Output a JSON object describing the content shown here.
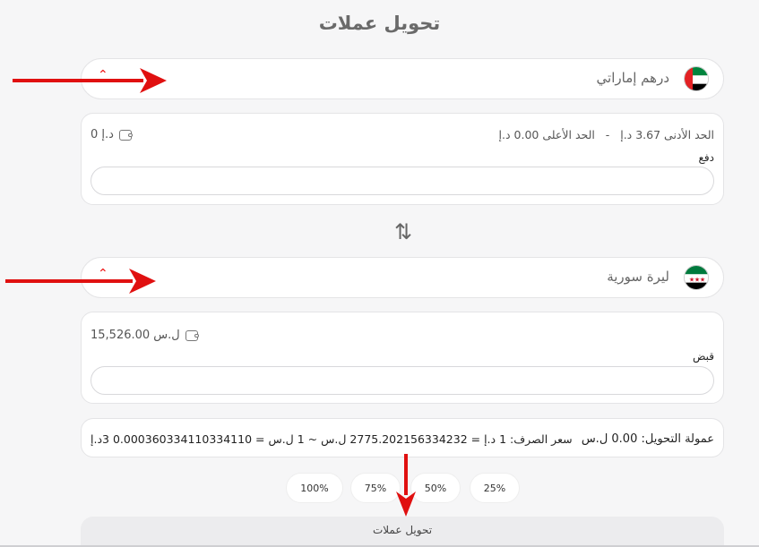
{
  "page_title": "تحويل عملات",
  "from_currency": {
    "name": "درهم إماراتي",
    "flag": "uae-flag-icon",
    "min_limit": "الحد الأدنى 3.67 د.إ",
    "separator": "-",
    "max_limit": "الحد الأعلى 0.00 د.إ",
    "balance": "0 د.إ",
    "field_label": "دفع",
    "amount_value": ""
  },
  "to_currency": {
    "name": "ليرة سورية",
    "flag": "syria-flag-icon",
    "balance": "15,526.00 ل.س",
    "field_label": "قبض",
    "amount_value": ""
  },
  "swap_icon": "swap-vertical-icon",
  "summary": {
    "fee": "عمولة التحويل: 0.00 ل.س",
    "rate": "سعر الصرف: 1 د.إ = 2775.202156334232 ل.س ~ 1 ل.س = 0.000360334110334110 3د.إ"
  },
  "percent_buttons": [
    "25%",
    "50%",
    "75%",
    "100%"
  ],
  "submit_label": "تحويل عملات",
  "colors": {
    "background": "#f6f6f7",
    "card": "#ffffff",
    "annotation_arrow": "#e01010"
  }
}
